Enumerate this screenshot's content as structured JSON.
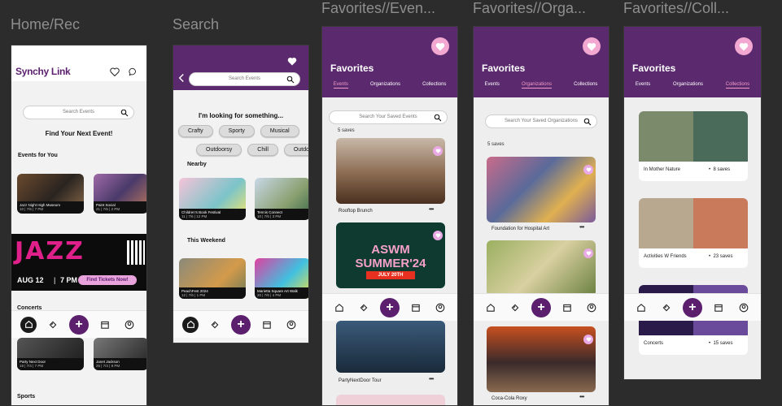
{
  "frames": {
    "home": "Home/Rec",
    "search": "Search",
    "fav_events": "Favorites//Even...",
    "fav_orgs": "Favorites//Orga...",
    "fav_colls": "Favorites//Coll..."
  },
  "home": {
    "logo": "Synchy Link",
    "search_placeholder": "Search Events",
    "headline": "Find Your Next Event!",
    "events_for_you": "Events for You",
    "cards": [
      {
        "title": "Jazz Night High Museum",
        "meta": "10 | 7/6 | 7 PM"
      },
      {
        "title": "Paint Social",
        "meta": "21 | 7/6 | 2 PM"
      }
    ],
    "banner": {
      "word": "JAZZ",
      "date": "AUG 12",
      "time": "7 PM",
      "cta": "Find Tickets Now!"
    },
    "concerts": "Concerts",
    "concert_cards": [
      {
        "title": "Party Next Door",
        "meta": "19 | 7/4 | 7 PM"
      },
      {
        "title": "Janet Jackson",
        "meta": "25 | 7/4 | 8 PM"
      }
    ],
    "sports": "Sports"
  },
  "search": {
    "search_placeholder": "Search Events",
    "prompt": "I'm looking for something...",
    "chips_row1": [
      "Crafty",
      "Sporty",
      "Musical"
    ],
    "chips_row2": [
      "Outdoorsy",
      "Chill",
      "Outdo"
    ],
    "nearby": "Nearby",
    "nearby_cards": [
      {
        "title": "Children's Book Festival",
        "meta": "11 | 7/6 | 12 PM"
      },
      {
        "title": "Tennis Connect",
        "meta": "10 | 7/6 | 3 PM"
      }
    ],
    "this_weekend": "This Weekend",
    "weekend_cards": [
      {
        "title": "PeachFest 2024",
        "meta": "12 | 7/6 | 1 PM"
      },
      {
        "title": "Marietta Square Art Walk",
        "meta": "20 | 7/6 | 4 PM"
      }
    ]
  },
  "fav": {
    "title": "Favorites",
    "tabs": [
      "Events",
      "Organizations",
      "Collections"
    ]
  },
  "fav_events": {
    "search_placeholder": "Search Your Saved Events",
    "saves": "5 saves",
    "items": [
      {
        "caption": "Rooftop Brunch",
        "banner": ""
      },
      {
        "caption": "",
        "banner": "ASWM SUMMER'24",
        "sub": "JULY 20TH"
      },
      {
        "caption": "PartyNextDoor Tour"
      }
    ]
  },
  "fav_orgs": {
    "search_placeholder": "Search Your Saved Organizations",
    "saves": "5 saves",
    "items": [
      {
        "caption": "Foundation for Hospital Art"
      },
      {
        "caption": ""
      },
      {
        "caption": "Coca-Cola Roxy"
      }
    ]
  },
  "fav_colls": {
    "items": [
      {
        "name": "In Mother Nature",
        "count": "8 saves"
      },
      {
        "name": "Activities W Friends",
        "count": "23 saves"
      },
      {
        "name": "Concerts",
        "count": "15 saves"
      }
    ]
  },
  "more_label": "•••"
}
